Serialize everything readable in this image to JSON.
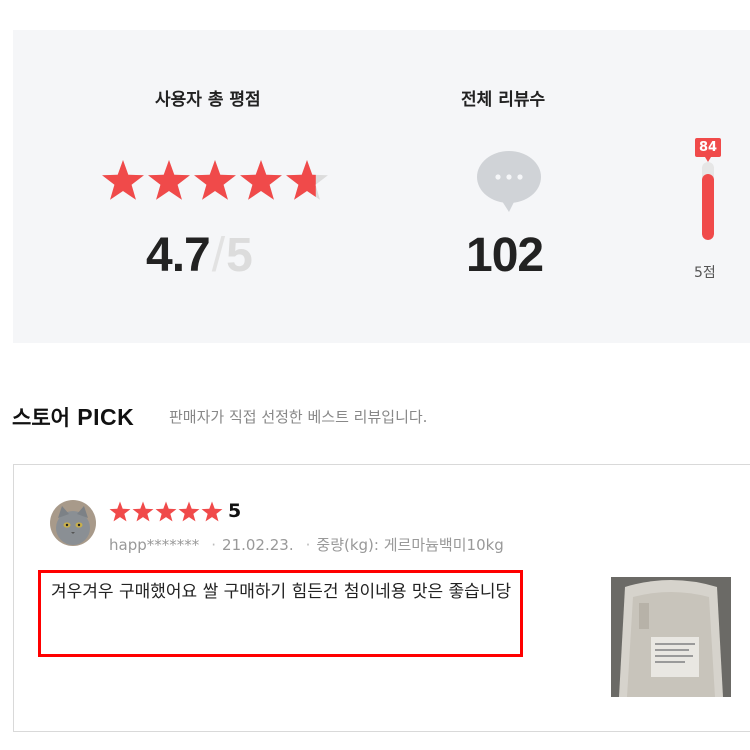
{
  "summary": {
    "rating_title": "사용자 총 평점",
    "rating_value": "4.7",
    "rating_slash": "/",
    "rating_max": "5",
    "rating_fraction": 0.94,
    "reviews_title": "전체 리뷰수",
    "review_count": "102",
    "distribution": {
      "badge": "84",
      "label": "5점",
      "fill_fraction": 0.84
    }
  },
  "store_pick": {
    "title_ko": "스토어",
    "title_en": "PICK",
    "description": "판매자가 직접 선정한 베스트 리뷰입니다."
  },
  "review": {
    "stars": 5,
    "score": "5",
    "user": "happ*******",
    "date": "21.02.23.",
    "option": "중량(kg): 게르마늄백미10kg",
    "text": "겨우겨우 구매했어요 쌀 구매하기 힘든건 첨이네용 맛은 좋습니당"
  },
  "colors": {
    "accent": "#f04a4a",
    "star_empty": "#dcdcdc",
    "panel_bg": "#f5f6f8",
    "highlight_border": "#ff0000"
  }
}
